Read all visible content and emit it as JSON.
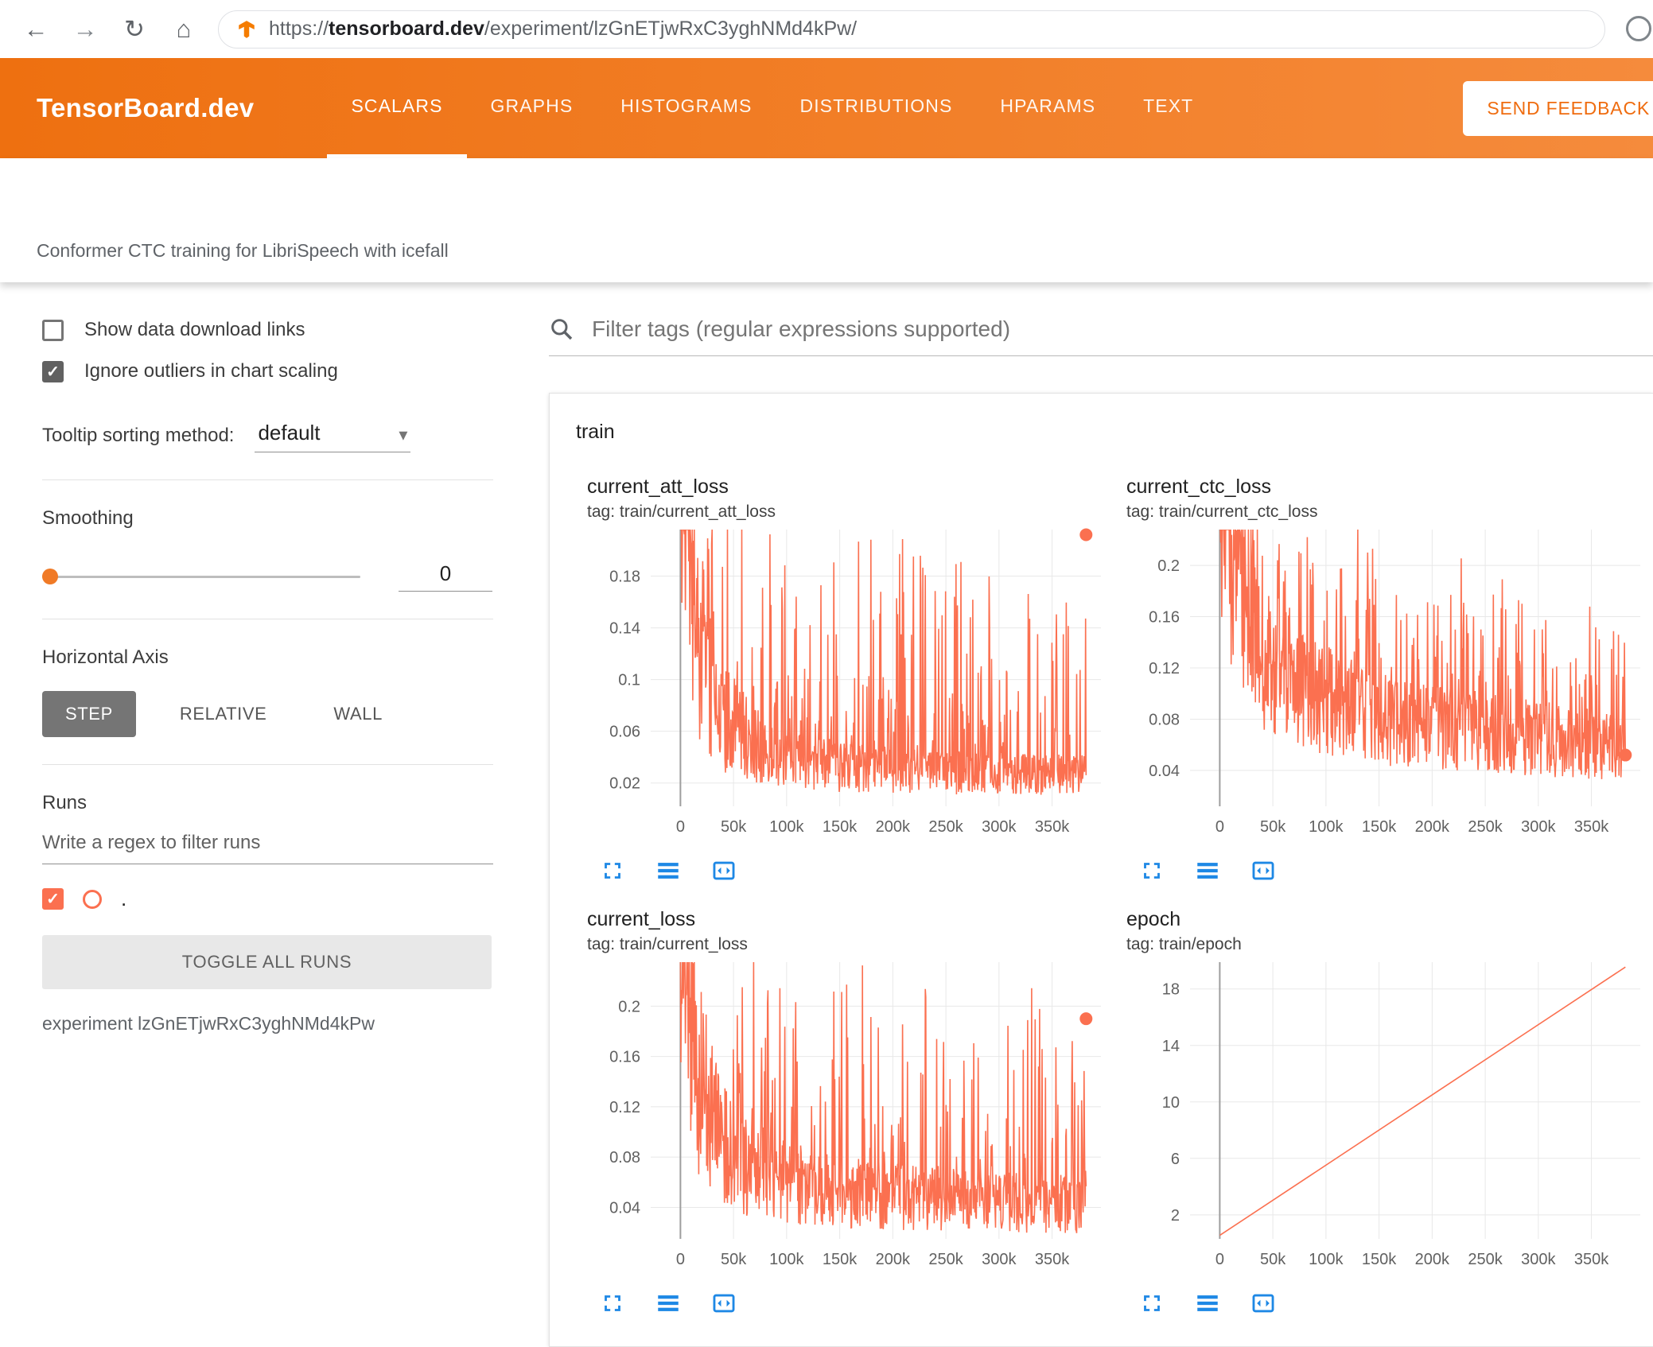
{
  "browser": {
    "url_scheme": "https://",
    "url_host": "tensorboard.dev",
    "url_path": "/experiment/lzGnETjwRxC3yghNMd4kPw/"
  },
  "header": {
    "logo": "TensorBoard.dev",
    "tabs": [
      {
        "label": "SCALARS",
        "active": true
      },
      {
        "label": "GRAPHS",
        "active": false
      },
      {
        "label": "HISTOGRAMS",
        "active": false
      },
      {
        "label": "DISTRIBUTIONS",
        "active": false
      },
      {
        "label": "HPARAMS",
        "active": false
      },
      {
        "label": "TEXT",
        "active": false
      }
    ],
    "feedback_button": "SEND FEEDBACK"
  },
  "experiment_title": "Conformer CTC training for LibriSpeech with icefall",
  "sidebar": {
    "show_download": {
      "label": "Show data download links",
      "checked": false
    },
    "ignore_outliers": {
      "label": "Ignore outliers in chart scaling",
      "checked": true
    },
    "tooltip_sorting": {
      "label": "Tooltip sorting method:",
      "value": "default"
    },
    "smoothing": {
      "label": "Smoothing",
      "value": "0"
    },
    "horizontal_axis": {
      "label": "Horizontal Axis",
      "options": [
        "STEP",
        "RELATIVE",
        "WALL"
      ],
      "selected": "STEP"
    },
    "runs": {
      "label": "Runs",
      "filter_placeholder": "Write a regex to filter runs",
      "run_name": ".",
      "run_checked": true,
      "toggle_button": "TOGGLE ALL RUNS",
      "experiment_caption": "experiment lzGnETjwRxC3yghNMd4kPw"
    }
  },
  "main": {
    "filter_placeholder": "Filter tags (regular expressions supported)",
    "group": "train"
  },
  "icons": {
    "browser": [
      "back",
      "forward",
      "reload",
      "home"
    ],
    "search": "magnifier",
    "chart_toolbar": [
      "fullscreen",
      "view-data-table",
      "fit-domain-to-data"
    ]
  },
  "colors": {
    "header_orange": "#ee7010",
    "header_orange_light": "#f58b3c",
    "run": "#fb7050",
    "icon_blue": "#1e88e5",
    "active_button_bg": "#757575"
  },
  "chart_data": [
    {
      "type": "line",
      "title": "current_att_loss",
      "tag": "tag: train/current_att_loss",
      "x_range": [
        -28000,
        396000
      ],
      "y_range": [
        0.002,
        0.216
      ],
      "x_ticks": [
        {
          "v": 0,
          "label": "0"
        },
        {
          "v": 50000,
          "label": "50k"
        },
        {
          "v": 100000,
          "label": "100k"
        },
        {
          "v": 150000,
          "label": "150k"
        },
        {
          "v": 200000,
          "label": "200k"
        },
        {
          "v": 250000,
          "label": "250k"
        },
        {
          "v": 300000,
          "label": "300k"
        },
        {
          "v": 350000,
          "label": "350k"
        }
      ],
      "y_ticks": [
        {
          "v": 0.02,
          "label": "0.02"
        },
        {
          "v": 0.06,
          "label": "0.06"
        },
        {
          "v": 0.1,
          "label": "0.1"
        },
        {
          "v": 0.14,
          "label": "0.14"
        },
        {
          "v": 0.18,
          "label": "0.18"
        }
      ],
      "baseline": [
        [
          0,
          0.34
        ],
        [
          15000,
          0.14
        ],
        [
          40000,
          0.07
        ],
        [
          80000,
          0.045
        ],
        [
          150000,
          0.032
        ],
        [
          250000,
          0.028
        ],
        [
          382000,
          0.026
        ]
      ],
      "noise": {
        "seed": 11,
        "jitter": 0.6,
        "spike_prob": 0.3,
        "spike_max": 0.17
      },
      "last_dot": [
        382000,
        0.212
      ]
    },
    {
      "type": "line",
      "title": "current_ctc_loss",
      "tag": "tag: train/current_ctc_loss",
      "x_range": [
        -28000,
        396000
      ],
      "y_range": [
        0.012,
        0.228
      ],
      "x_ticks": [
        {
          "v": 0,
          "label": "0"
        },
        {
          "v": 50000,
          "label": "50k"
        },
        {
          "v": 100000,
          "label": "100k"
        },
        {
          "v": 150000,
          "label": "150k"
        },
        {
          "v": 200000,
          "label": "200k"
        },
        {
          "v": 250000,
          "label": "250k"
        },
        {
          "v": 300000,
          "label": "300k"
        },
        {
          "v": 350000,
          "label": "350k"
        }
      ],
      "y_ticks": [
        {
          "v": 0.04,
          "label": "0.04"
        },
        {
          "v": 0.08,
          "label": "0.08"
        },
        {
          "v": 0.12,
          "label": "0.12"
        },
        {
          "v": 0.16,
          "label": "0.16"
        },
        {
          "v": 0.2,
          "label": "0.2"
        }
      ],
      "baseline": [
        [
          0,
          0.3
        ],
        [
          15000,
          0.19
        ],
        [
          40000,
          0.13
        ],
        [
          80000,
          0.1
        ],
        [
          150000,
          0.08
        ],
        [
          250000,
          0.068
        ],
        [
          382000,
          0.058
        ]
      ],
      "noise": {
        "seed": 23,
        "jitter": 0.45,
        "spike_prob": 0.32,
        "spike_max": 0.12
      },
      "last_dot": [
        382000,
        0.052
      ]
    },
    {
      "type": "line",
      "title": "current_loss",
      "tag": "tag: train/current_loss",
      "x_range": [
        -28000,
        396000
      ],
      "y_range": [
        0.015,
        0.235
      ],
      "x_ticks": [
        {
          "v": 0,
          "label": "0"
        },
        {
          "v": 50000,
          "label": "50k"
        },
        {
          "v": 100000,
          "label": "100k"
        },
        {
          "v": 150000,
          "label": "150k"
        },
        {
          "v": 200000,
          "label": "200k"
        },
        {
          "v": 250000,
          "label": "250k"
        },
        {
          "v": 300000,
          "label": "300k"
        },
        {
          "v": 350000,
          "label": "350k"
        }
      ],
      "y_ticks": [
        {
          "v": 0.04,
          "label": "0.04"
        },
        {
          "v": 0.08,
          "label": "0.08"
        },
        {
          "v": 0.12,
          "label": "0.12"
        },
        {
          "v": 0.16,
          "label": "0.16"
        },
        {
          "v": 0.2,
          "label": "0.2"
        }
      ],
      "baseline": [
        [
          0,
          0.33
        ],
        [
          15000,
          0.15
        ],
        [
          40000,
          0.09
        ],
        [
          80000,
          0.062
        ],
        [
          150000,
          0.052
        ],
        [
          250000,
          0.046
        ],
        [
          382000,
          0.042
        ]
      ],
      "noise": {
        "seed": 37,
        "jitter": 0.55,
        "spike_prob": 0.3,
        "spike_max": 0.16
      },
      "last_dot": [
        382000,
        0.19
      ]
    },
    {
      "type": "line",
      "title": "epoch",
      "tag": "tag: train/epoch",
      "x_range": [
        -28000,
        396000
      ],
      "y_range": [
        0.3,
        19.9
      ],
      "x_ticks": [
        {
          "v": 0,
          "label": "0"
        },
        {
          "v": 50000,
          "label": "50k"
        },
        {
          "v": 100000,
          "label": "100k"
        },
        {
          "v": 150000,
          "label": "150k"
        },
        {
          "v": 200000,
          "label": "200k"
        },
        {
          "v": 250000,
          "label": "250k"
        },
        {
          "v": 300000,
          "label": "300k"
        },
        {
          "v": 350000,
          "label": "350k"
        }
      ],
      "y_ticks": [
        {
          "v": 2,
          "label": "2"
        },
        {
          "v": 6,
          "label": "6"
        },
        {
          "v": 10,
          "label": "10"
        },
        {
          "v": 14,
          "label": "14"
        },
        {
          "v": 18,
          "label": "18"
        }
      ],
      "points": [
        [
          0,
          0.55
        ],
        [
          382000,
          19.55
        ]
      ]
    }
  ]
}
